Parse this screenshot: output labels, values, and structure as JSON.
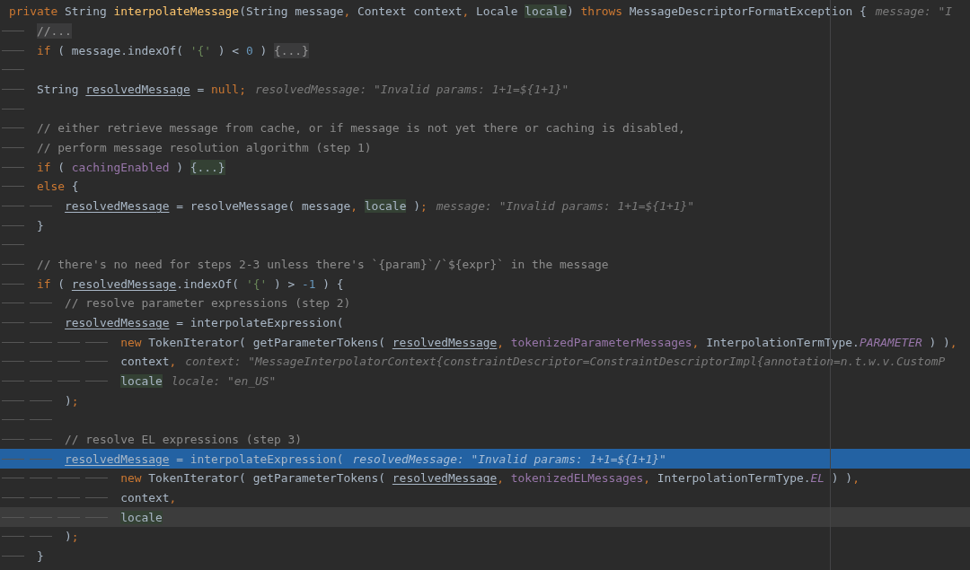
{
  "editor": {
    "lines": [
      {
        "kind": "statement",
        "selected": false,
        "caret": false,
        "segments": [
          {
            "kind": "code",
            "tokens": [
              {
                "kind": "keyword",
                "text": "private"
              },
              {
                "kind": "plain",
                "text": " String "
              },
              {
                "kind": "method",
                "text": "interpolateMessage"
              },
              {
                "kind": "plain",
                "text": "(String message"
              },
              {
                "kind": "punct",
                "text": ","
              },
              {
                "kind": "plain",
                "text": " Context context"
              },
              {
                "kind": "punct",
                "text": ","
              },
              {
                "kind": "plain",
                "text": " Locale "
              },
              {
                "kind": "param",
                "text": "locale"
              },
              {
                "kind": "plain",
                "text": ") "
              },
              {
                "kind": "keyword",
                "text": "throws"
              },
              {
                "kind": "plain",
                "text": " MessageDescriptorFormatException {"
              }
            ]
          },
          {
            "kind": "hint",
            "text": "message: \"I"
          }
        ],
        "children": [
          {
            "kind": "statement",
            "selected": false,
            "caret": false,
            "segments": [
              {
                "kind": "fold",
                "text": "//..."
              }
            ]
          },
          {
            "kind": "statement",
            "selected": false,
            "caret": false,
            "segments": [
              {
                "kind": "code",
                "tokens": [
                  {
                    "kind": "keyword",
                    "text": "if"
                  },
                  {
                    "kind": "plain",
                    "text": " ( message.indexOf( "
                  },
                  {
                    "kind": "string",
                    "text": "'{'"
                  },
                  {
                    "kind": "plain",
                    "text": " ) < "
                  },
                  {
                    "kind": "number",
                    "text": "0"
                  },
                  {
                    "kind": "plain",
                    "text": " ) "
                  }
                ]
              },
              {
                "kind": "fold",
                "text": "{...}"
              }
            ]
          },
          {
            "kind": "blank",
            "selected": false,
            "caret": false
          },
          {
            "kind": "statement",
            "selected": false,
            "caret": false,
            "segments": [
              {
                "kind": "code",
                "tokens": [
                  {
                    "kind": "plain",
                    "text": "String "
                  },
                  {
                    "kind": "local",
                    "text": "resolvedMessage"
                  },
                  {
                    "kind": "plain",
                    "text": " = "
                  },
                  {
                    "kind": "keyword",
                    "text": "null"
                  },
                  {
                    "kind": "punct",
                    "text": ";"
                  }
                ]
              },
              {
                "kind": "hint",
                "text": "resolvedMessage: \"Invalid params: 1+1=${1+1}\""
              }
            ]
          },
          {
            "kind": "blank",
            "selected": false,
            "caret": false
          },
          {
            "kind": "statement",
            "selected": false,
            "caret": false,
            "segments": [
              {
                "kind": "code",
                "tokens": [
                  {
                    "kind": "comment",
                    "text": "// either retrieve message from cache, or if message is not yet there or caching is disabled,"
                  }
                ]
              }
            ]
          },
          {
            "kind": "statement",
            "selected": false,
            "caret": false,
            "segments": [
              {
                "kind": "code",
                "tokens": [
                  {
                    "kind": "comment",
                    "text": "// perform message resolution algorithm (step 1)"
                  }
                ]
              }
            ]
          },
          {
            "kind": "statement",
            "selected": false,
            "caret": false,
            "segments": [
              {
                "kind": "code",
                "tokens": [
                  {
                    "kind": "keyword",
                    "text": "if"
                  },
                  {
                    "kind": "plain",
                    "text": " ( "
                  },
                  {
                    "kind": "field",
                    "text": "cachingEnabled"
                  },
                  {
                    "kind": "plain",
                    "text": " ) "
                  }
                ]
              },
              {
                "kind": "fold-active",
                "text": "{...}"
              }
            ]
          },
          {
            "kind": "statement",
            "selected": false,
            "caret": false,
            "segments": [
              {
                "kind": "code",
                "tokens": [
                  {
                    "kind": "keyword",
                    "text": "else"
                  },
                  {
                    "kind": "plain",
                    "text": " {"
                  }
                ]
              }
            ],
            "children": [
              {
                "kind": "statement",
                "selected": false,
                "caret": false,
                "segments": [
                  {
                    "kind": "code",
                    "tokens": [
                      {
                        "kind": "local",
                        "text": "resolvedMessage"
                      },
                      {
                        "kind": "plain",
                        "text": " = resolveMessage( message"
                      },
                      {
                        "kind": "punct",
                        "text": ", "
                      },
                      {
                        "kind": "param",
                        "text": "locale"
                      },
                      {
                        "kind": "plain",
                        "text": " )"
                      },
                      {
                        "kind": "punct",
                        "text": ";"
                      }
                    ]
                  },
                  {
                    "kind": "hint",
                    "text": "message: \"Invalid params: 1+1=${1+1}\""
                  }
                ]
              }
            ]
          },
          {
            "kind": "statement",
            "selected": false,
            "caret": false,
            "segments": [
              {
                "kind": "code",
                "tokens": [
                  {
                    "kind": "plain",
                    "text": "}"
                  }
                ]
              }
            ]
          },
          {
            "kind": "blank",
            "selected": false,
            "caret": false
          },
          {
            "kind": "statement",
            "selected": false,
            "caret": false,
            "segments": [
              {
                "kind": "code",
                "tokens": [
                  {
                    "kind": "comment",
                    "text": "// there's no need for steps 2-3 unless there's `{param}`/`${expr}` in the message"
                  }
                ]
              }
            ]
          },
          {
            "kind": "statement",
            "selected": false,
            "caret": false,
            "segments": [
              {
                "kind": "code",
                "tokens": [
                  {
                    "kind": "keyword",
                    "text": "if"
                  },
                  {
                    "kind": "plain",
                    "text": " ( "
                  },
                  {
                    "kind": "local",
                    "text": "resolvedMessage"
                  },
                  {
                    "kind": "plain",
                    "text": ".indexOf( "
                  },
                  {
                    "kind": "string",
                    "text": "'{'"
                  },
                  {
                    "kind": "plain",
                    "text": " ) > "
                  },
                  {
                    "kind": "number",
                    "text": "-1"
                  },
                  {
                    "kind": "plain",
                    "text": " ) {"
                  }
                ]
              }
            ],
            "children": [
              {
                "kind": "statement",
                "selected": false,
                "caret": false,
                "segments": [
                  {
                    "kind": "code",
                    "tokens": [
                      {
                        "kind": "comment",
                        "text": "// resolve parameter expressions (step 2)"
                      }
                    ]
                  }
                ]
              },
              {
                "kind": "statement",
                "selected": false,
                "caret": false,
                "segments": [
                  {
                    "kind": "code",
                    "tokens": [
                      {
                        "kind": "local",
                        "text": "resolvedMessage"
                      },
                      {
                        "kind": "plain",
                        "text": " = interpolateExpression("
                      }
                    ]
                  }
                ],
                "children": [
                  {
                    "kind": "continuation",
                    "selected": false,
                    "caret": false,
                    "segments": [
                      {
                        "kind": "code",
                        "tokens": [
                          {
                            "kind": "keyword",
                            "text": "new"
                          },
                          {
                            "kind": "plain",
                            "text": " TokenIterator( getParameterTokens( "
                          },
                          {
                            "kind": "local",
                            "text": "resolvedMessage"
                          },
                          {
                            "kind": "punct",
                            "text": ", "
                          },
                          {
                            "kind": "field",
                            "text": "tokenizedParameterMessages"
                          },
                          {
                            "kind": "punct",
                            "text": ","
                          },
                          {
                            "kind": "plain",
                            "text": " InterpolationTermType."
                          },
                          {
                            "kind": "constant",
                            "text": "PARAMETER"
                          },
                          {
                            "kind": "plain",
                            "text": " ) )"
                          },
                          {
                            "kind": "punct",
                            "text": ","
                          }
                        ]
                      }
                    ]
                  },
                  {
                    "kind": "continuation",
                    "selected": false,
                    "caret": false,
                    "segments": [
                      {
                        "kind": "code",
                        "tokens": [
                          {
                            "kind": "plain",
                            "text": "context"
                          },
                          {
                            "kind": "punct",
                            "text": ","
                          }
                        ]
                      },
                      {
                        "kind": "hint",
                        "text": "context: \"MessageInterpolatorContext{constraintDescriptor=ConstraintDescriptorImpl{annotation=n.t.w.v.CustomP"
                      }
                    ]
                  },
                  {
                    "kind": "continuation",
                    "selected": false,
                    "caret": false,
                    "segments": [
                      {
                        "kind": "code",
                        "tokens": [
                          {
                            "kind": "param",
                            "text": "locale"
                          }
                        ]
                      },
                      {
                        "kind": "hint",
                        "text": "locale: \"en_US\""
                      }
                    ]
                  }
                ]
              },
              {
                "kind": "statement",
                "selected": false,
                "caret": false,
                "segments": [
                  {
                    "kind": "code",
                    "tokens": [
                      {
                        "kind": "plain",
                        "text": ")"
                      },
                      {
                        "kind": "punct",
                        "text": ";"
                      }
                    ]
                  }
                ]
              },
              {
                "kind": "blank",
                "selected": false,
                "caret": false
              },
              {
                "kind": "statement",
                "selected": false,
                "caret": false,
                "segments": [
                  {
                    "kind": "code",
                    "tokens": [
                      {
                        "kind": "comment",
                        "text": "// resolve EL expressions (step 3)"
                      }
                    ]
                  }
                ]
              },
              {
                "kind": "statement",
                "selected": true,
                "caret": false,
                "segments": [
                  {
                    "kind": "code",
                    "tokens": [
                      {
                        "kind": "local",
                        "text": "resolvedMessage"
                      },
                      {
                        "kind": "plain",
                        "text": " = interpolateExpression("
                      }
                    ]
                  },
                  {
                    "kind": "hint",
                    "text": "resolvedMessage: \"Invalid params: 1+1=${1+1}\""
                  }
                ],
                "children": [
                  {
                    "kind": "continuation",
                    "selected": false,
                    "caret": false,
                    "segments": [
                      {
                        "kind": "code",
                        "tokens": [
                          {
                            "kind": "keyword",
                            "text": "new"
                          },
                          {
                            "kind": "plain",
                            "text": " TokenIterator( getParameterTokens( "
                          },
                          {
                            "kind": "local",
                            "text": "resolvedMessage"
                          },
                          {
                            "kind": "punct",
                            "text": ", "
                          },
                          {
                            "kind": "field",
                            "text": "tokenizedELMessages"
                          },
                          {
                            "kind": "punct",
                            "text": ","
                          },
                          {
                            "kind": "plain",
                            "text": " InterpolationTermType."
                          },
                          {
                            "kind": "constant",
                            "text": "EL"
                          },
                          {
                            "kind": "plain",
                            "text": " ) )"
                          },
                          {
                            "kind": "punct",
                            "text": ","
                          }
                        ]
                      }
                    ]
                  },
                  {
                    "kind": "continuation",
                    "selected": false,
                    "caret": false,
                    "segments": [
                      {
                        "kind": "code",
                        "tokens": [
                          {
                            "kind": "plain",
                            "text": "context"
                          },
                          {
                            "kind": "punct",
                            "text": ","
                          }
                        ]
                      }
                    ]
                  },
                  {
                    "kind": "continuation",
                    "selected": false,
                    "caret": true,
                    "segments": [
                      {
                        "kind": "code",
                        "tokens": [
                          {
                            "kind": "param",
                            "text": "locale"
                          }
                        ]
                      }
                    ]
                  }
                ]
              },
              {
                "kind": "statement",
                "selected": false,
                "caret": false,
                "segments": [
                  {
                    "kind": "code",
                    "tokens": [
                      {
                        "kind": "plain",
                        "text": ")"
                      },
                      {
                        "kind": "punct",
                        "text": ";"
                      }
                    ]
                  }
                ]
              }
            ]
          },
          {
            "kind": "statement",
            "selected": false,
            "caret": false,
            "segments": [
              {
                "kind": "code",
                "tokens": [
                  {
                    "kind": "plain",
                    "text": "}"
                  }
                ]
              }
            ]
          }
        ]
      }
    ]
  }
}
